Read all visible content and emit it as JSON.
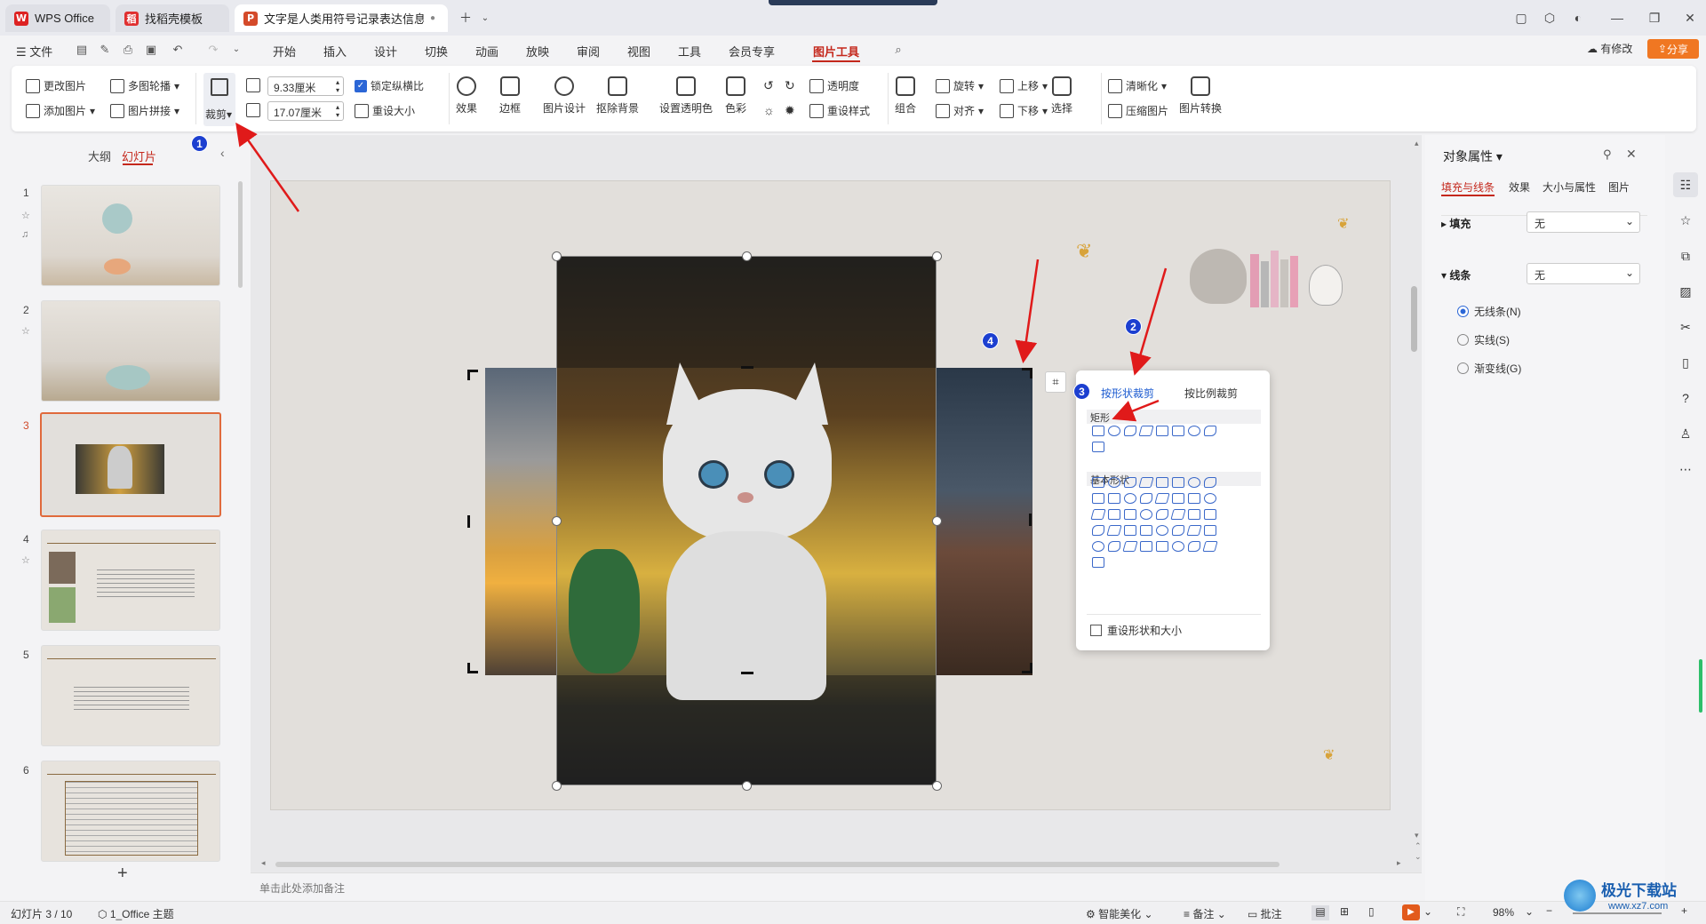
{
  "tabs": [
    {
      "label": "WPS Office"
    },
    {
      "label": "找稻壳模板"
    },
    {
      "label": "文字是人类用符号记录表达信息以..."
    }
  ],
  "menu": {
    "file": "文件",
    "items": [
      "开始",
      "插入",
      "设计",
      "切换",
      "动画",
      "放映",
      "审阅",
      "视图",
      "工具",
      "会员专享",
      "图片工具"
    ],
    "modified": "有修改",
    "share": "分享"
  },
  "ribbon": {
    "change_picture": "更改图片",
    "multi_carousel": "多图轮播",
    "add_picture": "添加图片",
    "picture_collage": "图片拼接",
    "crop": "裁剪",
    "width_value": "9.33厘米",
    "height_value": "17.07厘米",
    "lock_ratio": "锁定纵横比",
    "reset_size": "重设大小",
    "effects": "效果",
    "border": "边框",
    "picture_design": "图片设计",
    "remove_bg": "抠除背景",
    "set_transparent": "设置透明色",
    "color": "色彩",
    "transparency": "透明度",
    "reset_style": "重设样式",
    "group": "组合",
    "rotate": "旋转",
    "align": "对齐",
    "bring_forward": "上移",
    "send_backward": "下移",
    "select": "选择",
    "sharpen": "清晰化",
    "compress": "压缩图片",
    "convert": "图片转换"
  },
  "left_panel": {
    "outline_tab": "大纲",
    "slides_tab": "幻灯片",
    "slides": [
      {
        "num": "1"
      },
      {
        "num": "2"
      },
      {
        "num": "3"
      },
      {
        "num": "4"
      },
      {
        "num": "5"
      },
      {
        "num": "6"
      }
    ],
    "add_slide": "+"
  },
  "notes_placeholder": "单击此处添加备注",
  "crop_popup": {
    "tab_shape": "按形状裁剪",
    "tab_ratio": "按比例裁剪",
    "section_rect": "矩形",
    "section_basic": "基本形状",
    "reset": "重设形状和大小"
  },
  "right_panel": {
    "title": "对象属性",
    "tabs": [
      "填充与线条",
      "效果",
      "大小与属性",
      "图片"
    ],
    "fill_label": "填充",
    "fill_value": "无",
    "line_label": "线条",
    "line_value": "无",
    "options": [
      "无线条(N)",
      "实线(S)",
      "渐变线(G)"
    ]
  },
  "status": {
    "slide_info": "幻灯片 3 / 10",
    "theme": "1_Office 主题",
    "smart_beautify": "智能美化",
    "notes": "备注",
    "comments": "批注",
    "zoom": "98%"
  },
  "annotations": [
    "1",
    "2",
    "3",
    "4"
  ],
  "watermark": {
    "site": "极光下载站",
    "url": "www.xz7.com"
  },
  "colors": {
    "accent": "#c4281c",
    "link": "#1c5bd0",
    "badge": "#1c3fd0",
    "arrow": "#e01a1a"
  }
}
